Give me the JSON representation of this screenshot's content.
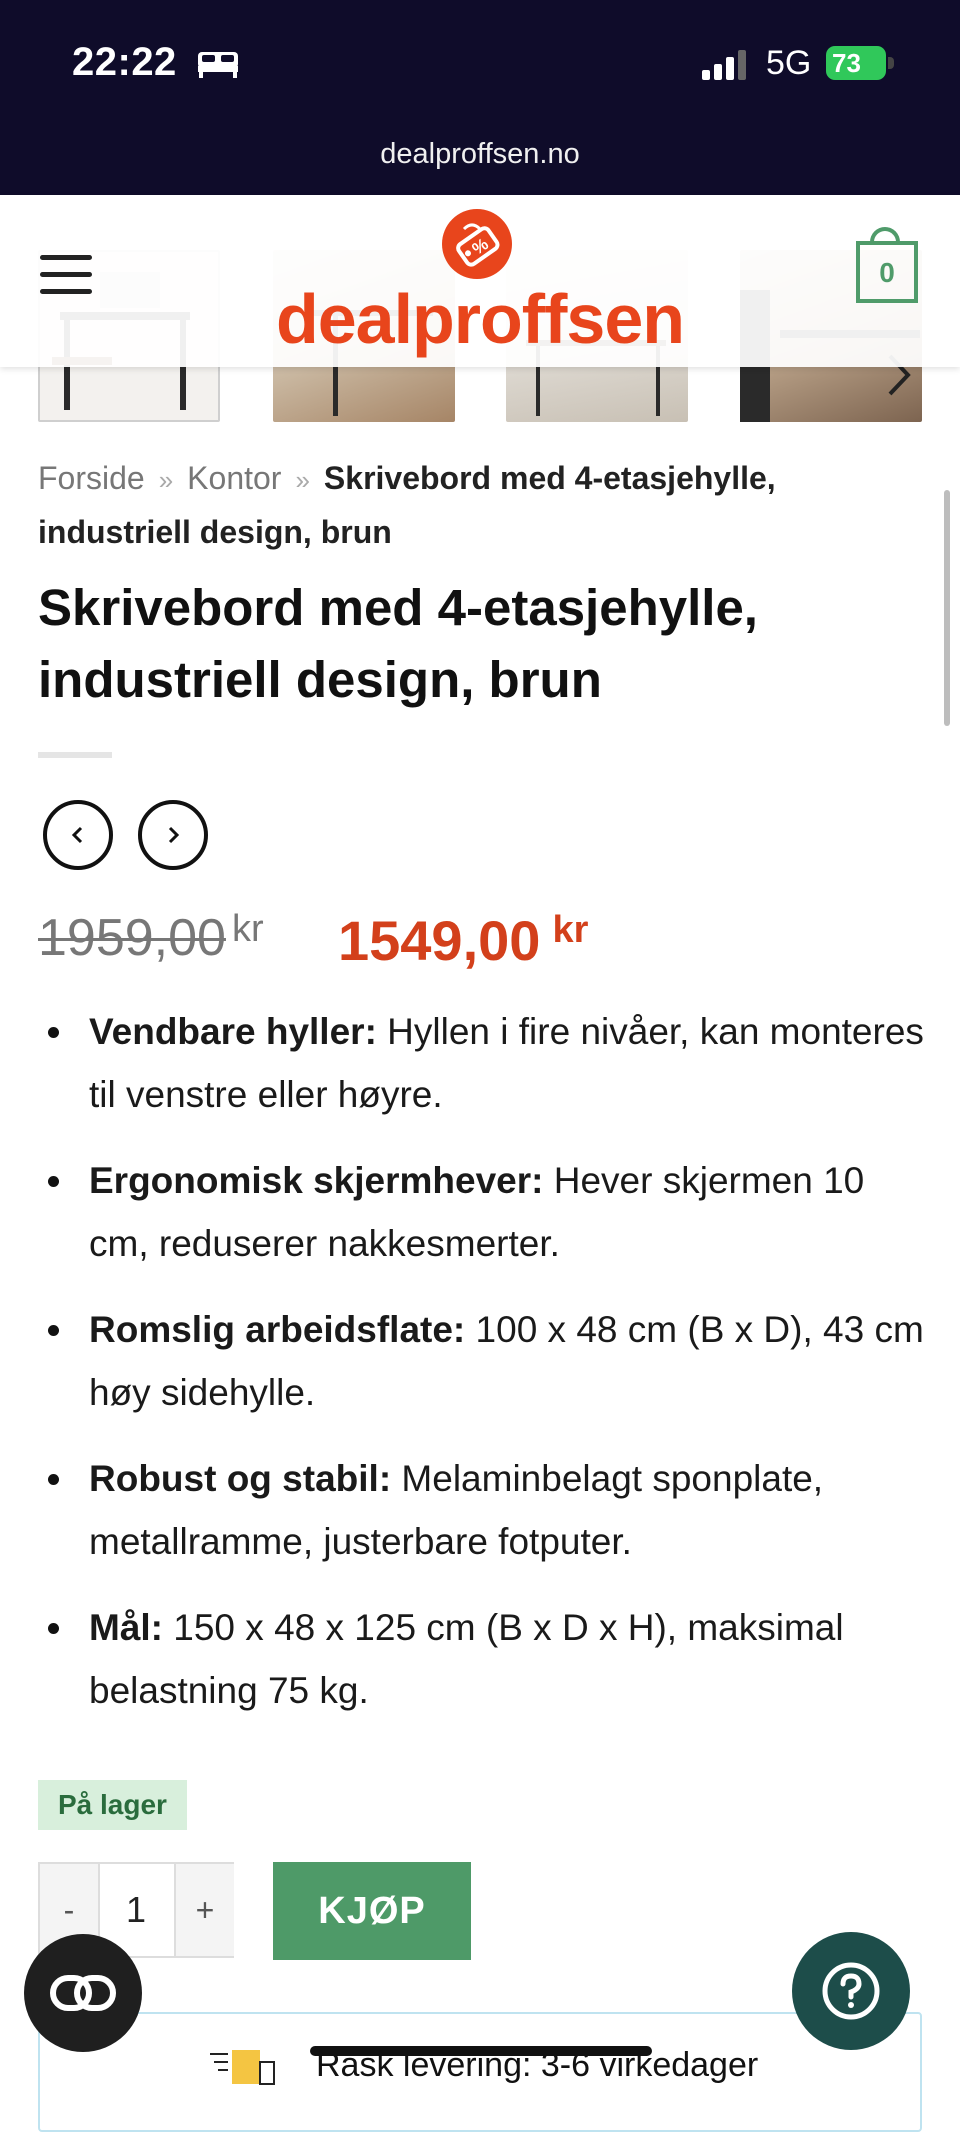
{
  "status_bar": {
    "time": "22:22",
    "network": "5G",
    "battery": "73",
    "battery_color": "#30c85a"
  },
  "browser": {
    "url": "dealproffsen.no"
  },
  "header": {
    "logo_text": "dealproffsen",
    "cart_count": "0",
    "brand_color": "#e8451c",
    "accent_color": "#4f9b6a"
  },
  "breadcrumb": {
    "items": [
      "Forside",
      "Kontor"
    ],
    "separator": "»",
    "current": "Skrivebord med 4-etasjehylle, industriell design, brun"
  },
  "product": {
    "title": "Skrivebord med 4-etasjehylle, industriell design, brun",
    "old_price": "1959,00",
    "new_price": "1549,00",
    "currency": "kr",
    "features": [
      {
        "label": "Vendbare hyller:",
        "text": " Hyllen i fire nivåer, kan monteres til venstre eller høyre."
      },
      {
        "label": "Ergonomisk skjermhever:",
        "text": " Hever skjermen 10 cm, reduserer nakkesmerter."
      },
      {
        "label": "Romslig arbeidsflate:",
        "text": " 100 x 48 cm (B x D), 43 cm høy sidehylle."
      },
      {
        "label": "Robust og stabil:",
        "text": " Melaminbelagt sponplate, metallramme, justerbare fotputer."
      },
      {
        "label": "Mål:",
        "text": " 150 x 48 x 125 cm (B x D x H), maksimal belastning 75 kg."
      }
    ],
    "stock_label": "På lager"
  },
  "purchase": {
    "minus": "-",
    "quantity": "1",
    "plus": "+",
    "buy_label": "KJØP"
  },
  "delivery": {
    "text": "Rask levering: 3-6 virkedager"
  },
  "icons": {
    "bed": "bed-icon",
    "signal": "signal-icon",
    "battery": "battery-icon",
    "menu": "hamburger-menu-icon",
    "cart": "shopping-bag-icon",
    "gallery_next": "chevron-right-icon",
    "prev": "chevron-left-icon",
    "next": "chevron-right-icon",
    "chat": "chat-icon",
    "help": "help-icon",
    "delivery": "delivery-truck-icon"
  }
}
